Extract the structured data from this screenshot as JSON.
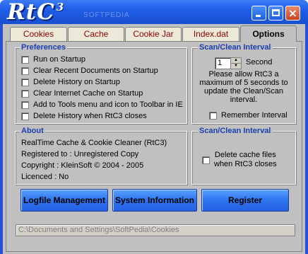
{
  "app": {
    "logo_main": "RtC",
    "logo_sup": "3",
    "watermark": "SOFTPEDIA",
    "title_buttons": {
      "minimize": "minimize",
      "maximize": "maximize",
      "close": "×"
    }
  },
  "tabs": [
    {
      "label": "Cookies",
      "active": false
    },
    {
      "label": "Cache",
      "active": false
    },
    {
      "label": "Cookie Jar",
      "active": false
    },
    {
      "label": "Index.dat",
      "active": false
    },
    {
      "label": "Options",
      "active": true
    }
  ],
  "preferences": {
    "title": "Preferences",
    "items": [
      "Run on Startup",
      "Clear Recent Documents on Startup",
      "Delete History on Startup",
      "Clear Internet Cache on Startup",
      "Add to Tools menu and icon to Toolbar in IE",
      "Delete History when RtC3 closes"
    ]
  },
  "scan_interval": {
    "title": "Scan/Clean Interval",
    "value": "1",
    "unit": "Second",
    "note_lines": [
      "Please allow RtC3 a",
      "maximum of 5 seconds to",
      "update the Clean/Scan",
      "interval."
    ],
    "remember_label": "Remember Interval"
  },
  "about": {
    "title": "About",
    "lines": [
      "RealTime Cache & Cookie Cleaner (RtC3)",
      "Registered to : Unregistered Copy",
      "Copyright : KleinSoft © 2004 - 2005",
      "Licenced : No"
    ]
  },
  "scan_interval2": {
    "title": "Scan/Clean Interval",
    "checkbox_line1": "Delete cache files",
    "checkbox_line2": "when RtC3 closes"
  },
  "buttons": {
    "logfile": "Logfile Management",
    "system": "System Information",
    "register": "Register"
  },
  "path": "C:\\Documents and Settings\\SoftPedia\\Cookies"
}
